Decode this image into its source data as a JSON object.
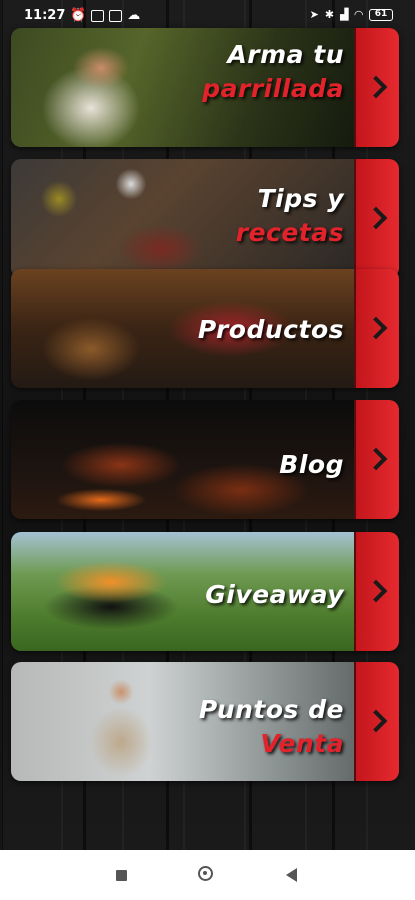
{
  "status_bar": {
    "time": "11:27",
    "battery": "61"
  },
  "menu": [
    {
      "id": "parrillada",
      "line1": "Arma tu",
      "line2": "parrillada",
      "icon": "chevron-right-icon"
    },
    {
      "id": "tips",
      "line1": "Tips y",
      "line2": "recetas",
      "icon": "chevron-right-icon"
    },
    {
      "id": "productos",
      "line1": "Productos",
      "line2": "",
      "icon": "chevron-right-icon"
    },
    {
      "id": "blog",
      "line1": "Blog",
      "line2": "",
      "icon": "chevron-right-icon"
    },
    {
      "id": "giveaway",
      "line1": "Giveaway",
      "line2": "",
      "icon": "chevron-right-icon"
    },
    {
      "id": "puntos",
      "line1": "Puntos de",
      "line2": "Venta",
      "icon": "chevron-right-icon"
    }
  ],
  "colors": {
    "accent_red": "#e3232b",
    "tab_red": "#d42026",
    "background": "#161616"
  }
}
